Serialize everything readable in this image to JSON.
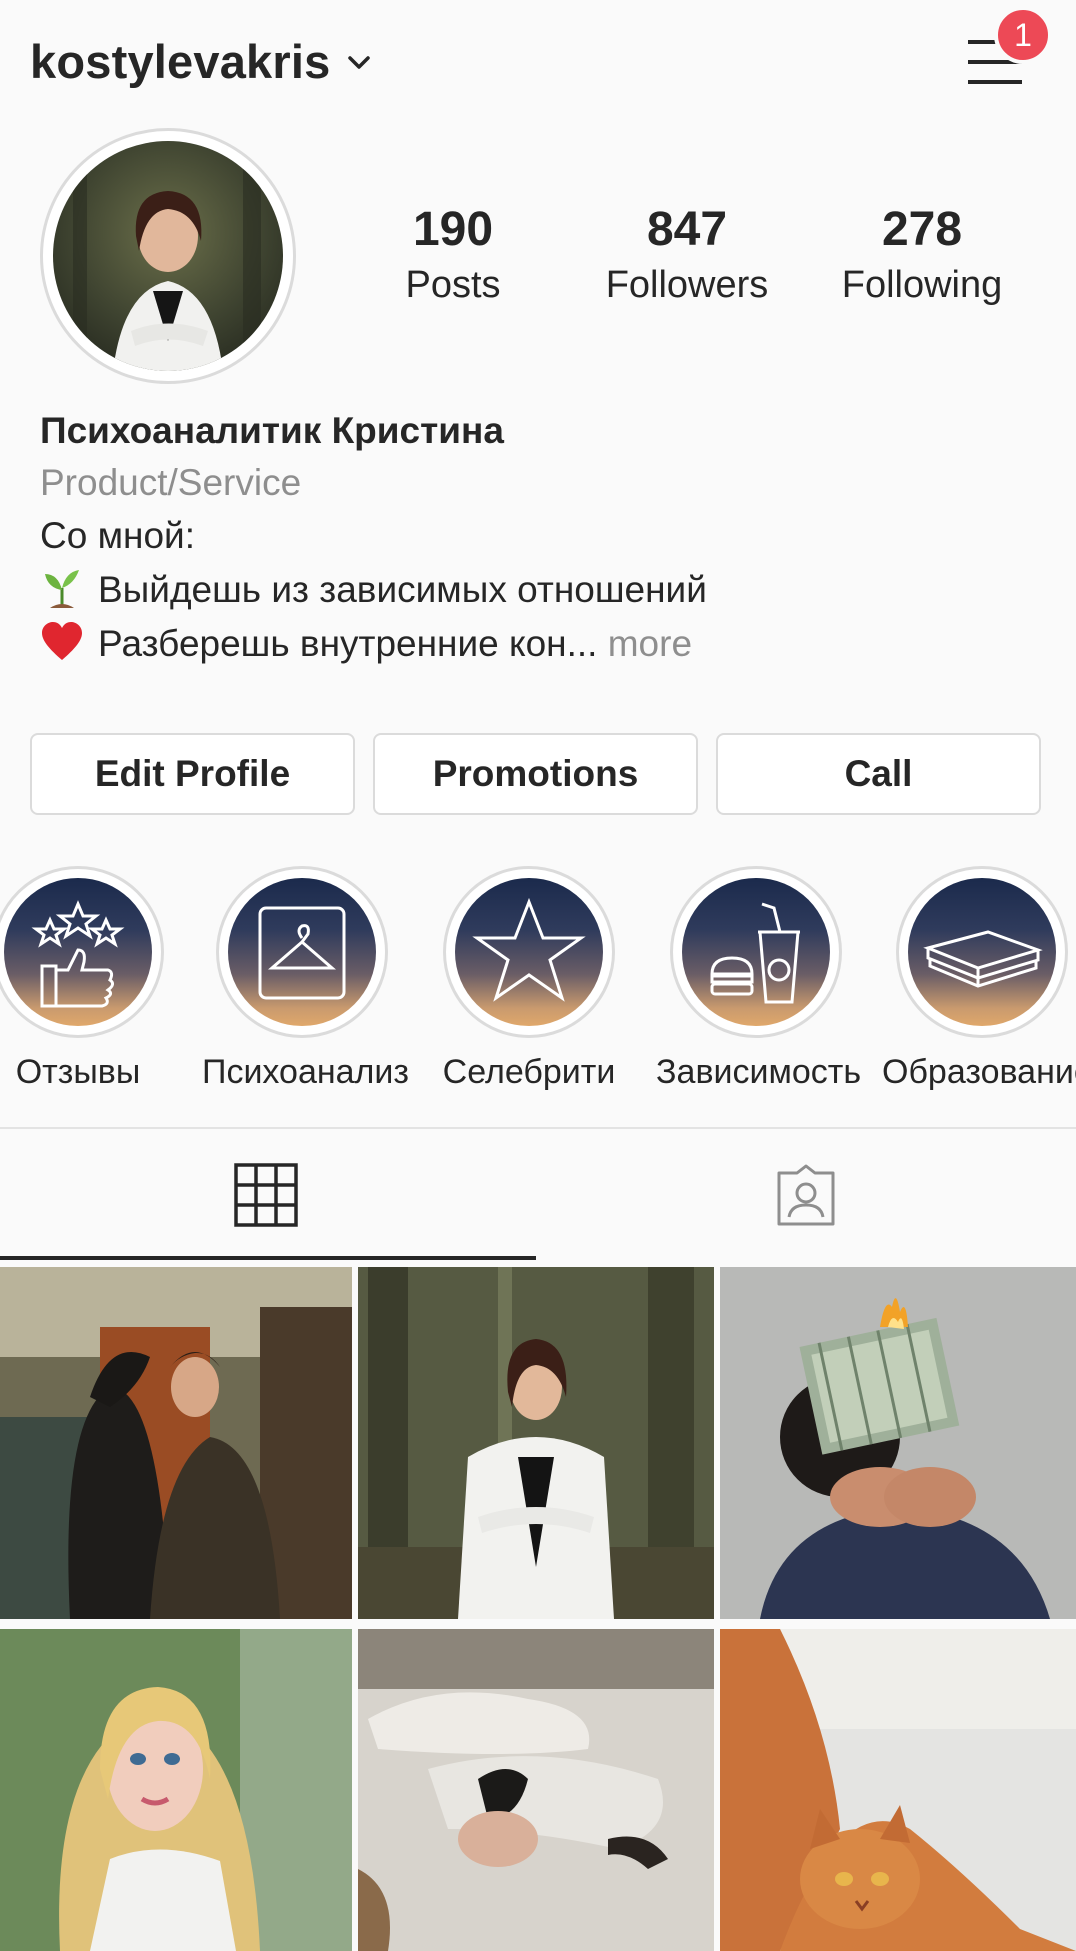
{
  "header": {
    "username": "kostylevakris",
    "notification_count": "1"
  },
  "stats": [
    {
      "value": "190",
      "label": "Posts"
    },
    {
      "value": "847",
      "label": "Followers"
    },
    {
      "value": "278",
      "label": "Following"
    }
  ],
  "bio": {
    "name": "Психоаналитик Кристина",
    "category": "Product/Service",
    "line1": "Со мной:",
    "line2": "Выйдешь из зависимых отношений",
    "line3": "Разберешь внутренние кон...",
    "more": "more"
  },
  "buttons": {
    "edit_profile": "Edit Profile",
    "promotions": "Promotions",
    "call": "Call"
  },
  "highlights": [
    {
      "label": "Отзывы",
      "icon": "thumbs-up-stars-icon"
    },
    {
      "label": "Психоанализ",
      "icon": "hanger-icon"
    },
    {
      "label": "Селебрити",
      "icon": "star-icon"
    },
    {
      "label": "Зависимость",
      "icon": "fast-food-icon"
    },
    {
      "label": "Образование",
      "icon": "book-icon"
    }
  ],
  "tabs": [
    {
      "name": "grid",
      "icon": "grid-icon",
      "active": true
    },
    {
      "name": "tagged",
      "icon": "tagged-person-icon",
      "active": false
    }
  ],
  "colors": {
    "accent_badge": "#ed4956",
    "text": "#262626",
    "secondary_text": "#8e8e8e",
    "border": "#dbdbdb"
  }
}
